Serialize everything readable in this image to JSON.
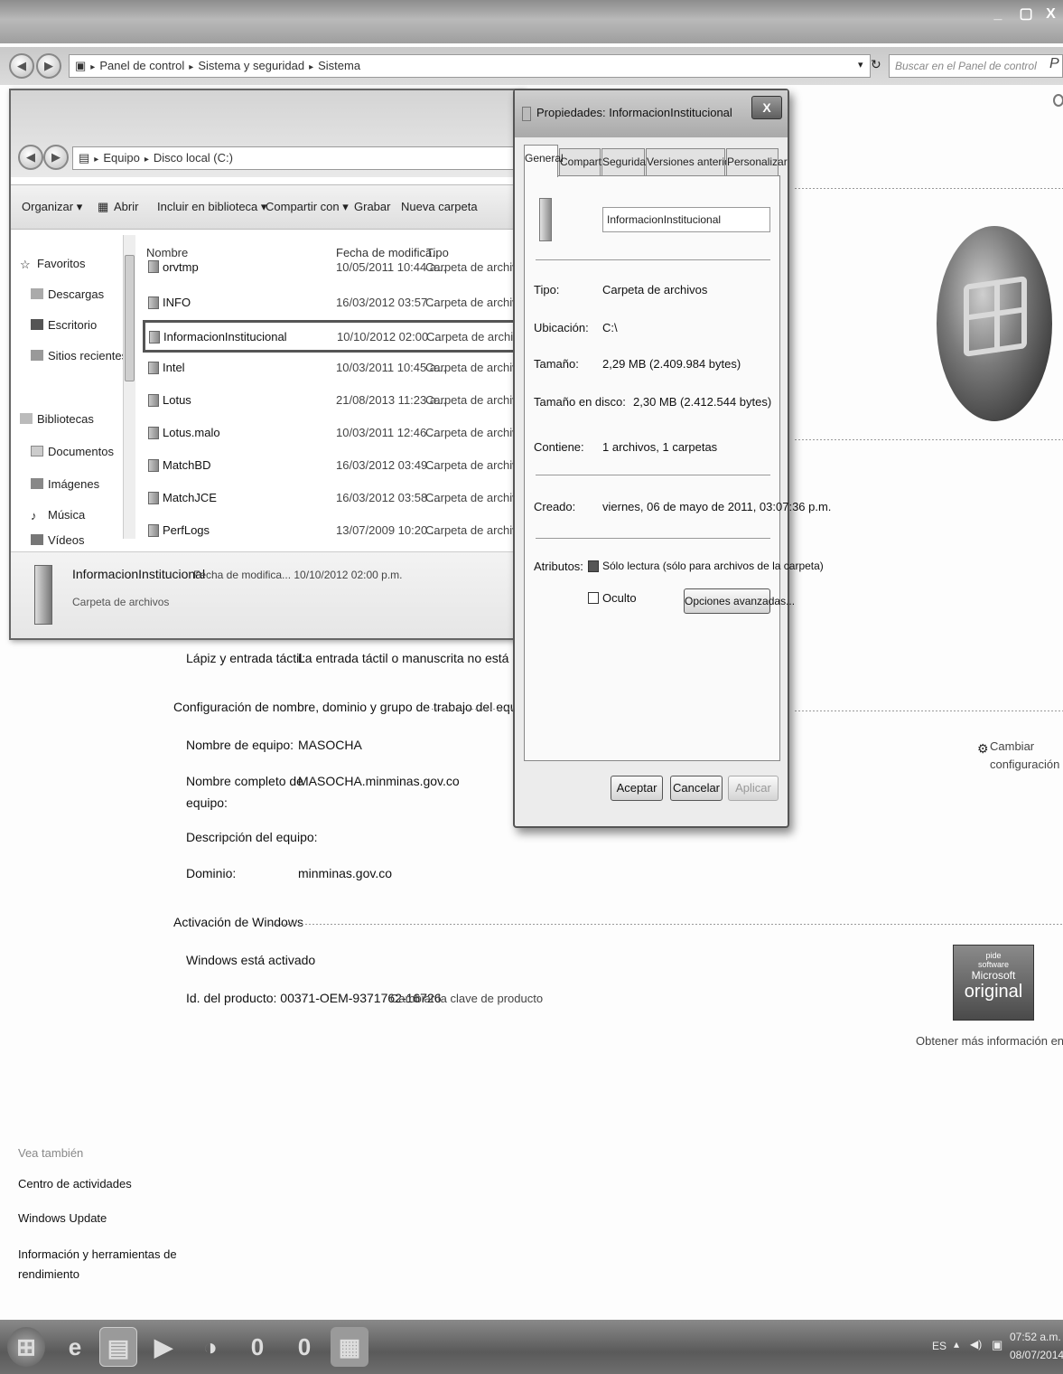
{
  "window": {
    "controls": [
      "_",
      "▢",
      "X"
    ],
    "breadcrumb": [
      "Panel de control",
      "Sistema y seguridad",
      "Sistema"
    ],
    "search_placeholder": "Buscar en el Panel de control",
    "search_icon": "P"
  },
  "system": {
    "pen_label": "Lápiz y entrada táctil:",
    "pen_value": "La entrada táctil o manuscrita no está disponible para e",
    "computer_section": "Configuración de nombre, dominio y grupo de trabajo del equipo",
    "computer_name_label": "Nombre de equipo:",
    "computer_name_value": "MASOCHA",
    "full_name_label_1": "Nombre completo de",
    "full_name_label_2": "equipo:",
    "full_name_value": "MASOCHA.minminas.gov.co",
    "description_label": "Descripción del equipo:",
    "domain_label": "Dominio:",
    "domain_value": "minminas.gov.co",
    "change_settings_1": "Cambiar",
    "change_settings_2": "configuración",
    "activation_section": "Activación de Windows",
    "activated_text": "Windows está activado",
    "product_id_text": "Id. del producto: 00371-OEM-9371762-16726",
    "change_key_link": "Cambiar la clave de producto",
    "genuine_line1": "pide",
    "genuine_line2": "software",
    "genuine_line3": "Microsoft",
    "genuine_line4": "original",
    "more_info_link": "Obtener más información en línea...",
    "see_also": "Vea también",
    "links": [
      "Centro de actividades",
      "Windows Update",
      "Información y herramientas de",
      "rendimiento"
    ]
  },
  "explorer": {
    "breadcrumb": [
      "Equipo",
      "Disco local (C:)"
    ],
    "toolbar": [
      "Organizar ▾",
      "Abrir",
      "Incluir en biblioteca ▾",
      "Compartir con ▾",
      "Grabar",
      "Nueva carpeta"
    ],
    "nav": [
      "Favoritos",
      "Descargas",
      "Escritorio",
      "Sitios recientes",
      "Bibliotecas",
      "Documentos",
      "Imágenes",
      "Música",
      "Vídeos"
    ],
    "columns": [
      "Nombre",
      "Fecha de modifica...",
      "Tipo"
    ],
    "rows": [
      {
        "name": "orvtmp",
        "date": "10/05/2011 10:44 a...",
        "type": "Carpeta de archivos"
      },
      {
        "name": "INFO",
        "date": "16/03/2012 03:57 ...",
        "type": "Carpeta de archivos"
      },
      {
        "name": "InformacionInstitucional",
        "date": "10/10/2012 02:00 ...",
        "type": "Carpeta de archivos"
      },
      {
        "name": "Intel",
        "date": "10/03/2011 10:45 a...",
        "type": "Carpeta de archivos"
      },
      {
        "name": "Lotus",
        "date": "21/08/2013 11:23 a...",
        "type": "Carpeta de archivos"
      },
      {
        "name": "Lotus.malo",
        "date": "10/03/2011 12:46 ...",
        "type": "Carpeta de archivos"
      },
      {
        "name": "MatchBD",
        "date": "16/03/2012 03:49 ...",
        "type": "Carpeta de archivos"
      },
      {
        "name": "MatchJCE",
        "date": "16/03/2012 03:58 ...",
        "type": "Carpeta de archivos"
      },
      {
        "name": "PerfLogs",
        "date": "13/07/2009 10:20 ...",
        "type": "Carpeta de archivos"
      }
    ],
    "details_name": "InformacionInstitucional",
    "details_date": "Fecha de modifica... 10/10/2012 02:00 p.m.",
    "details_type": "Carpeta de archivos"
  },
  "dialog": {
    "title": "Propiedades: InformacionInstitucional",
    "close": "X",
    "tabs": [
      "General",
      "Compartir",
      "Seguridad",
      "Versiones anteriores",
      "Personalizar"
    ],
    "folder_name": "InformacionInstitucional",
    "tipo_label": "Tipo:",
    "tipo_value": "Carpeta de archivos",
    "ubicacion_label": "Ubicación:",
    "ubicacion_value": "C:\\",
    "tamano_label": "Tamaño:",
    "tamano_value": "2,29 MB (2.409.984 bytes)",
    "tamano_disco_label": "Tamaño en disco:",
    "tamano_disco_value": "2,30 MB (2.412.544 bytes)",
    "contiene_label": "Contiene:",
    "contiene_value": "1 archivos, 1 carpetas",
    "creado_label": "Creado:",
    "creado_value": "viernes, 06 de mayo de 2011, 03:07:36 p.m.",
    "atributos_label": "Atributos:",
    "readonly_label": "Sólo lectura (sólo para archivos de la carpeta)",
    "hidden_label": "Oculto",
    "advanced_button": "Opciones avanzadas...",
    "ok_button": "Aceptar",
    "cancel_button": "Cancelar",
    "apply_button": "Aplicar"
  },
  "taskbar": {
    "lang": "ES",
    "time": "07:52 a.m.",
    "date": "08/07/2014"
  }
}
